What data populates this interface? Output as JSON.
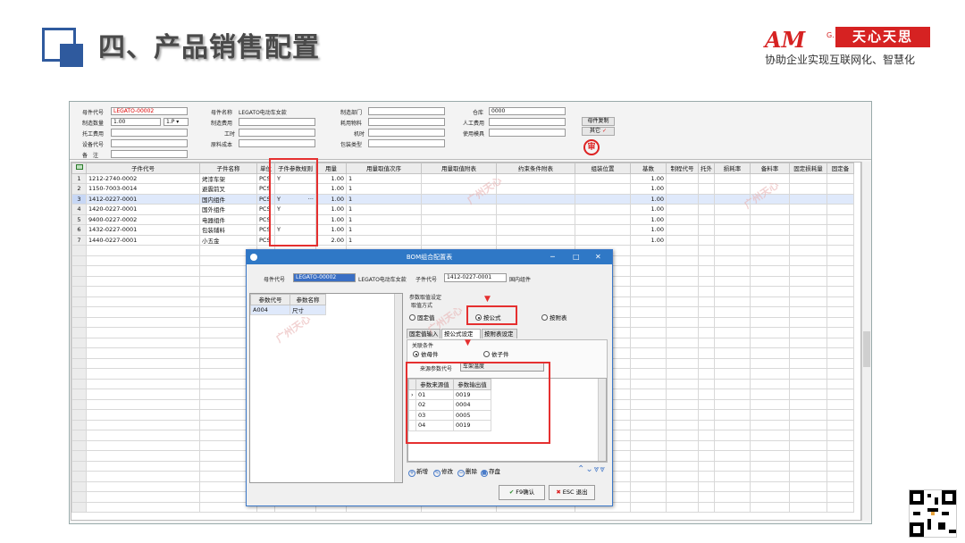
{
  "slide": {
    "title": "四、产品销售配置",
    "logo_am": "AM",
    "logo_co": "G.",
    "logo_name": "天心天思",
    "tagline": "协助企业实现互联网化、智慧化"
  },
  "header": {
    "parent_code_label": "母件代号",
    "parent_code": "LEGATO-00002",
    "parent_name_label": "母件名称",
    "parent_name": "LEGATO电动车女款",
    "dept_label": "制造部门",
    "dept": "",
    "warehouse_label": "仓库",
    "warehouse": "0000",
    "qty_label": "制造数量",
    "qty": "1.00",
    "unit": "1.P",
    "mfg_cost_label": "制造费用",
    "mfg_cost": "",
    "material_label": "耗用物料",
    "material": "",
    "labor_label": "人工费用",
    "labor": "",
    "piece_labor_label": "托工费用",
    "piece_labor": "",
    "hours_label": "工时",
    "hours": "",
    "machine_label": "机时",
    "machine": "",
    "mold_label": "使用模具",
    "mold": "",
    "equip_label": "设备代号",
    "equip": "",
    "raw_cost_label": "原料成本",
    "raw_cost": "",
    "pack_label": "包装类型",
    "pack": "",
    "note_label": "备　注",
    "note": "",
    "copy_btn": "母件复制",
    "other_btn": "其它",
    "other_check": "✓",
    "stamp": "审"
  },
  "grid": {
    "columns": [
      "子件代号",
      "子件名称",
      "单位",
      "子件参数规则",
      "用量",
      "用量取值次序",
      "用量取值附表",
      "约束条件附表",
      "组装位置",
      "基数",
      "制程代号",
      "托外",
      "损耗率",
      "备料率",
      "固定损耗量",
      "固定备"
    ],
    "rows": [
      {
        "n": "1",
        "code": "1212-2740-0002",
        "name": "烤漆车架",
        "unit": "PCS",
        "rule": "Y",
        "qty": "1.00",
        "order": "1",
        "base": "1.00"
      },
      {
        "n": "2",
        "code": "1150-7003-0014",
        "name": "避震前叉",
        "unit": "PCS",
        "rule": "",
        "qty": "1.00",
        "order": "1",
        "base": "1.00"
      },
      {
        "n": "3",
        "code": "1412-0227-0001",
        "name": "国内组件",
        "unit": "PCS",
        "rule": "Y",
        "more": "···",
        "qty": "1.00",
        "order": "1",
        "base": "1.00"
      },
      {
        "n": "4",
        "code": "1420-0227-0001",
        "name": "国外组件",
        "unit": "PCS",
        "rule": "Y",
        "qty": "1.00",
        "order": "1",
        "base": "1.00"
      },
      {
        "n": "5",
        "code": "9400-0227-0002",
        "name": "电器组件",
        "unit": "PCS",
        "rule": "",
        "qty": "1.00",
        "order": "1",
        "base": "1.00"
      },
      {
        "n": "6",
        "code": "1432-0227-0001",
        "name": "包装辅料",
        "unit": "PCS",
        "rule": "Y",
        "qty": "1.00",
        "order": "1",
        "base": "1.00"
      },
      {
        "n": "7",
        "code": "1440-0227-0001",
        "name": "小五金",
        "unit": "PCS",
        "rule": "",
        "qty": "2.00",
        "order": "1",
        "base": "1.00"
      }
    ]
  },
  "dialog": {
    "title": "BOM组合配置表",
    "minimize": "─",
    "maximize": "□",
    "close": "✕",
    "parent_code_label": "母件代号",
    "parent_code": "LEGATO-00002",
    "parent_name": "LEGATO电动车女款",
    "child_code_label": "子件代号",
    "child_code": "1412-0227-0001",
    "child_name": "国内组件",
    "param_cols": [
      "参数代号",
      "参数名称"
    ],
    "params": [
      {
        "code": "A004",
        "name": "尺寸"
      }
    ],
    "setting_group": "参数取值设定",
    "method_label": "取值方式",
    "radio_fixed": "固定值",
    "radio_formula": "按公式",
    "radio_table": "按附表",
    "tab_fixed": "固定值输入",
    "tab_formula": "按公式设定",
    "tab_table": "按附表设定",
    "link_label": "关联条件",
    "radio_parent": "依母件",
    "radio_child": "依子件",
    "src_label": "来源参数代号",
    "src_value": "车架温度",
    "val_cols": [
      "参数来源值",
      "参数输出值"
    ],
    "values": [
      {
        "src": "01",
        "out": "0019"
      },
      {
        "src": "02",
        "out": "0004"
      },
      {
        "src": "03",
        "out": "0005"
      },
      {
        "src": "04",
        "out": "0019"
      }
    ],
    "btn_new": "新增",
    "btn_modify": "修改",
    "btn_delete": "删除",
    "btn_save": "存盘",
    "nav_arrows": "⌃⌄⩔⩔",
    "confirm": "F9确认",
    "exit": "ESC 退出"
  },
  "watermark": "广州天心"
}
